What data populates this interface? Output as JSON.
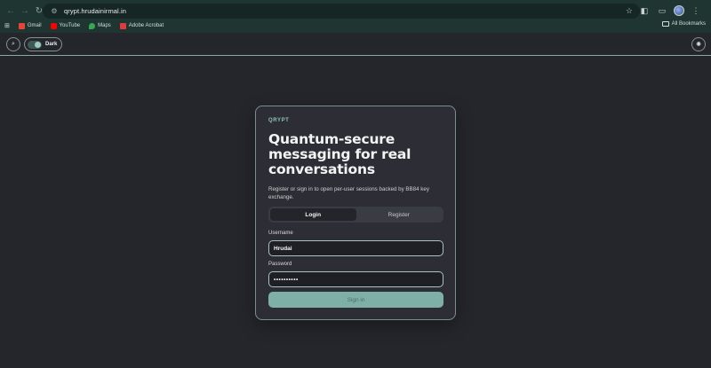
{
  "browser": {
    "url": "qrypt.hrudainirmal.in",
    "bookmarks": [
      {
        "label": "Gmail",
        "icon": "gmail-icon",
        "color": "#ea4335"
      },
      {
        "label": "YouTube",
        "icon": "youtube-icon",
        "color": "#ff0000"
      },
      {
        "label": "Maps",
        "icon": "maps-icon",
        "color": "#34a853"
      },
      {
        "label": "Adobe Acrobat",
        "icon": "acrobat-icon",
        "color": "#e13a3a"
      }
    ],
    "all_bookmarks": "All Bookmarks"
  },
  "header": {
    "theme_label": "Dark"
  },
  "card": {
    "brand": "QRYPT",
    "title": "Quantum-secure messaging for real conversations",
    "subtitle": "Register or sign in to open per-user sessions backed by BB84 key exchange.",
    "tabs": [
      {
        "label": "Login",
        "active": true
      },
      {
        "label": "Register",
        "active": false
      }
    ],
    "username_label": "Username",
    "username_value": "Hrudai",
    "password_label": "Password",
    "password_value": "••••••••••",
    "submit_label": "Sign in"
  },
  "colors": {
    "accent": "#7fb0a8",
    "background": "#25262c",
    "card": "#2d2e35"
  }
}
